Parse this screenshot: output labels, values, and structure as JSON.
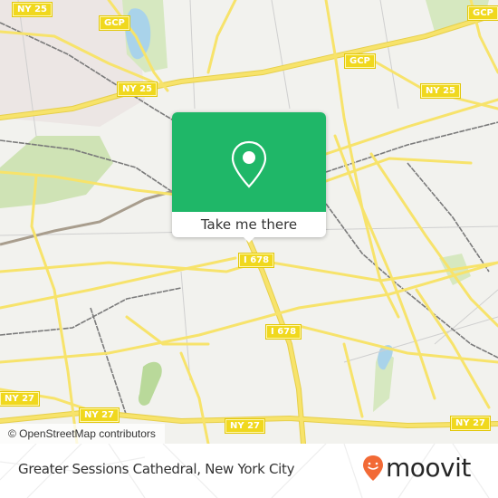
{
  "map": {
    "attribution": "© OpenStreetMap contributors",
    "colors": {
      "background": "#f2f2ee",
      "road": "#f7e36b",
      "road_casing": "#e6cf4a",
      "park": "#cfe3b5",
      "water": "#a9d3ea",
      "rail": "#7a7a7a",
      "shield": "#f0d81e"
    },
    "route_shields": [
      {
        "label": "NY 25"
      },
      {
        "label": "GCP"
      },
      {
        "label": "NY 25"
      },
      {
        "label": "GCP"
      },
      {
        "label": "GCP"
      },
      {
        "label": "NY 25"
      },
      {
        "label": "I 678"
      },
      {
        "label": "I 678"
      },
      {
        "label": "NY 27"
      },
      {
        "label": "NY 27"
      },
      {
        "label": "NY 27"
      },
      {
        "label": "NY 27"
      }
    ]
  },
  "popup": {
    "icon": "map-pin-icon",
    "button_label": "Take me there",
    "accent_color": "#1fb768"
  },
  "footer": {
    "place_title": "Greater Sessions Cathedral, New York City",
    "brand_name": "moovit",
    "brand_color": "#f26a36"
  }
}
